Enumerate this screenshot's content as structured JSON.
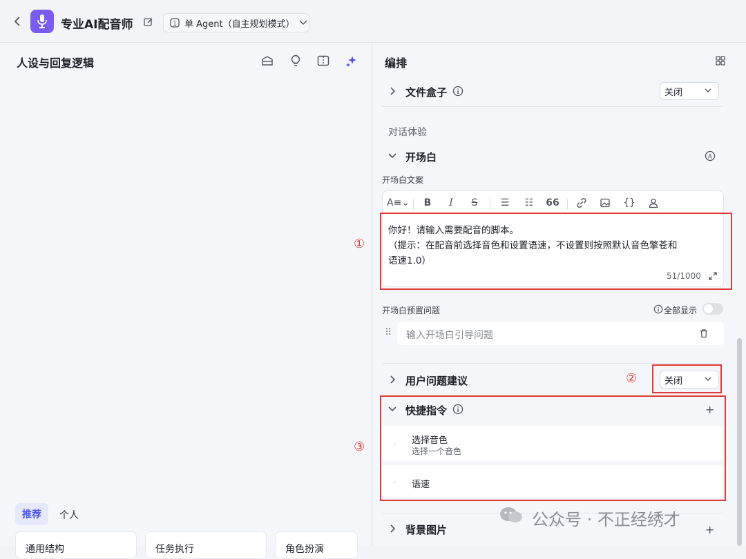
{
  "header": {
    "app_title": "专业AI配音师",
    "mode_label": "单 Agent（自主规划模式）"
  },
  "left_panel": {
    "title": "人设与回复逻辑",
    "tabs": [
      "推荐",
      "个人"
    ],
    "templates": [
      "通用结构",
      "任务执行",
      "角色扮演"
    ]
  },
  "right_panel": {
    "title": "编排",
    "file_box": {
      "label": "文件盒子",
      "value": "关闭"
    },
    "section_label": "对话体验",
    "opening": {
      "label": "开场白",
      "copy_label": "开场白文案",
      "text_line1": "你好！请输入需要配音的脚本。",
      "text_line2": "（提示：在配音前选择音色和设置语速，不设置则按照默认音色擎苍和",
      "text_line3": "语速1.0）",
      "char_count": "51/1000",
      "preset_label": "开场白预置问题",
      "show_all_label": "全部显示",
      "input_placeholder": "输入开场白引导问题"
    },
    "suggestions": {
      "label": "用户问题建议",
      "value": "关闭"
    },
    "shortcuts": {
      "label": "快捷指令",
      "items": [
        {
          "title": "选择音色",
          "desc": "选择一个音色"
        },
        {
          "title": "语速",
          "desc": ""
        }
      ]
    },
    "background": {
      "label": "背景图片"
    }
  },
  "annotations": [
    "①",
    "②",
    "③"
  ],
  "watermark": "公众号 · 不正经绣才",
  "colors": {
    "accent": "#4d53e8",
    "annotation_red": "#e03a3a",
    "avatar": "#7b5cf0"
  }
}
